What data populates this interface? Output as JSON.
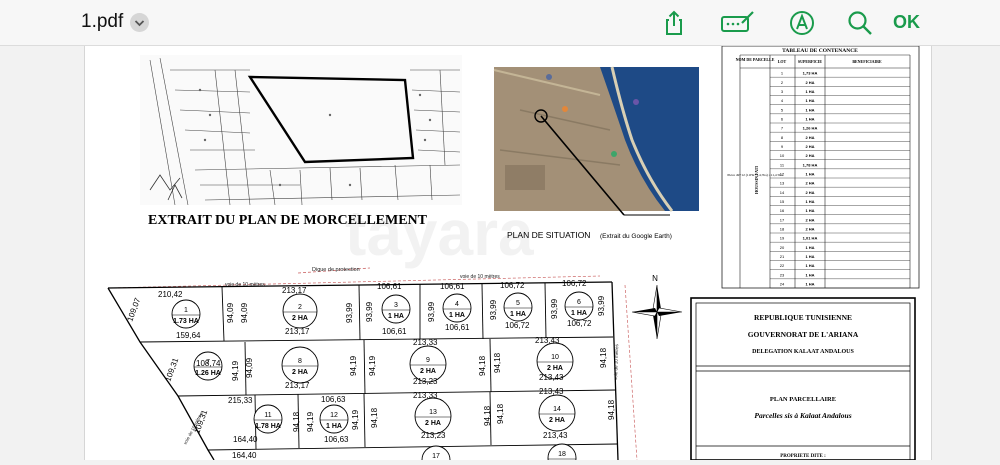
{
  "toolbar": {
    "filename": "1.pdf",
    "ok_label": "OK",
    "icons": [
      "share-icon",
      "annotate-icon",
      "markup-icon",
      "search-icon"
    ]
  },
  "doc": {
    "extrait_title": "EXTRAIT DU PLAN DE MORCELLEMENT",
    "situation_title": "PLAN DE SITUATION",
    "situation_sub": "(Extrait du Google Earth)",
    "digue": "Digue de protection",
    "voie": "voie de 10 mètres",
    "watermark": "tayara",
    "north": "N",
    "tableau": {
      "title": "TABLEAU DE CONTENANCE",
      "headers": [
        "NOM DE PARCELLE",
        "LOT",
        "SUPERFICIE",
        "BENEFICIAIRE"
      ],
      "parcel_label": "HOUSSIN FATI",
      "parcel_sub": "Pièce 49+12 (11Ha+1,4,7ha) =11,4 5ha",
      "rows": [
        [
          "1",
          "1,73 HA"
        ],
        [
          "2",
          "2 HA"
        ],
        [
          "3",
          "1 HA"
        ],
        [
          "4",
          "1 HA"
        ],
        [
          "5",
          "1 HA"
        ],
        [
          "6",
          "1 HA"
        ],
        [
          "7",
          "1,26 HA"
        ],
        [
          "8",
          "2 HA"
        ],
        [
          "9",
          "2 HA"
        ],
        [
          "10",
          "2 HA"
        ],
        [
          "11",
          "1,78 HA"
        ],
        [
          "12",
          "1 HA"
        ],
        [
          "13",
          "2 HA"
        ],
        [
          "14",
          "2 HA"
        ],
        [
          "15",
          "1 HA"
        ],
        [
          "16",
          "1 HA"
        ],
        [
          "17",
          "2 HA"
        ],
        [
          "18",
          "2 HA"
        ],
        [
          "19",
          "1,01 HA"
        ],
        [
          "20",
          "1 HA"
        ],
        [
          "21",
          "1 HA"
        ],
        [
          "22",
          "1 HA"
        ],
        [
          "23",
          "1 HA"
        ],
        [
          "24",
          "1 HA"
        ]
      ]
    },
    "cartouche": {
      "l1": "REPUBLIQUE TUNISIENNE",
      "l2": "GOUVERNORAT DE L'ARIANA",
      "l3": "DELEGATION KALAAT ANDALOUS",
      "l4": "PLAN PARCELLAIRE",
      "l5": "Parcelles sis à Kalaat Andalous",
      "l6": "PROPRIETE DITE :"
    },
    "lots": [
      {
        "n": "1",
        "area": "1.73 HA"
      },
      {
        "n": "2",
        "area": "2 HA"
      },
      {
        "n": "3",
        "area": "1 HA"
      },
      {
        "n": "4",
        "area": "1 HA"
      },
      {
        "n": "5",
        "area": "1 HA"
      },
      {
        "n": "6",
        "area": "1 HA"
      },
      {
        "n": "7",
        "area": "1.26 HA"
      },
      {
        "n": "8",
        "area": "2 HA"
      },
      {
        "n": "9",
        "area": "2 HA"
      },
      {
        "n": "10",
        "area": "2 HA"
      },
      {
        "n": "11",
        "area": "1.78 HA"
      },
      {
        "n": "12",
        "area": "1 HA"
      },
      {
        "n": "13",
        "area": "2 HA"
      },
      {
        "n": "14",
        "area": "2 HA"
      },
      {
        "n": "17",
        "area": ""
      },
      {
        "n": "18",
        "area": ""
      }
    ],
    "dims": {
      "d210_42": "210,42",
      "d213_17": "213,17",
      "d106_61": "106,61",
      "d106_72": "106,72",
      "d109_07": "109,07",
      "d94_09": "94,09",
      "d93_99": "93,99",
      "d159_64": "159,64",
      "d213_33": "213,33",
      "d213_43": "213,43",
      "d109_31": "109,31",
      "d94_19": "94,19",
      "d108_74": "108,74",
      "d94_18": "94,18",
      "d213_23": "213,23",
      "d215_33": "215,33",
      "d106_63": "106,63",
      "d164_40": "164,40"
    }
  }
}
